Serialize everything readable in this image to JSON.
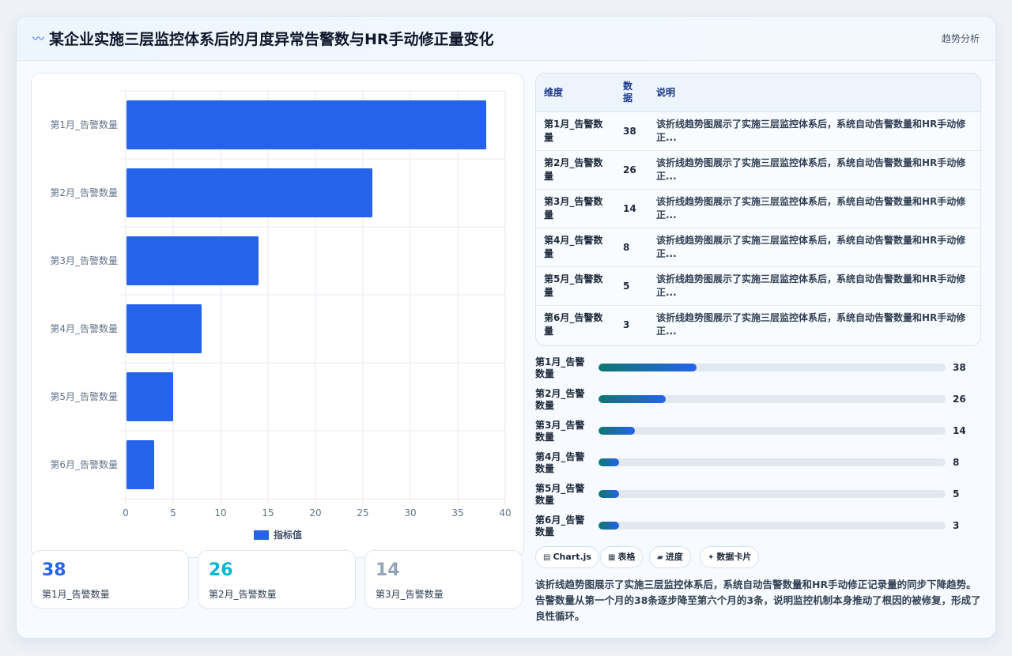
{
  "header": {
    "icon": "trend-icon",
    "title": "某企业实施三层监控体系后的月度异常告警数与HR手动修正量变化",
    "tag": "趋势分析"
  },
  "chart_data": {
    "type": "bar",
    "orientation": "horizontal",
    "categories": [
      "第1月_告警数量",
      "第2月_告警数量",
      "第3月_告警数量",
      "第4月_告警数量",
      "第5月_告警数量",
      "第6月_告警数量"
    ],
    "series": [
      {
        "name": "指标值",
        "values": [
          38,
          26,
          14,
          8,
          5,
          3
        ],
        "color": "#2563eb"
      }
    ],
    "xlim": [
      0,
      40
    ],
    "xticks": [
      0,
      5,
      10,
      15,
      20,
      25,
      30,
      35,
      40
    ],
    "grid": true,
    "legend": "bottom"
  },
  "kpis": [
    {
      "value": "38",
      "label": "第1月_告警数量",
      "color": "#2563eb"
    },
    {
      "value": "26",
      "label": "第2月_告警数量",
      "color": "#06b6d4"
    },
    {
      "value": "14",
      "label": "第3月_告警数量",
      "color": "#94a3b8"
    }
  ],
  "table": {
    "headers": [
      "维度",
      "数据",
      "说明"
    ],
    "rows": [
      {
        "dim": "第1月_告警数量",
        "val": "38",
        "desc": "该折线趋势图展示了实施三层监控体系后，系统自动告警数量和HR手动修正..."
      },
      {
        "dim": "第2月_告警数量",
        "val": "26",
        "desc": "该折线趋势图展示了实施三层监控体系后，系统自动告警数量和HR手动修正..."
      },
      {
        "dim": "第3月_告警数量",
        "val": "14",
        "desc": "该折线趋势图展示了实施三层监控体系后，系统自动告警数量和HR手动修正..."
      },
      {
        "dim": "第4月_告警数量",
        "val": "8",
        "desc": "该折线趋势图展示了实施三层监控体系后，系统自动告警数量和HR手动修正..."
      },
      {
        "dim": "第5月_告警数量",
        "val": "5",
        "desc": "该折线趋势图展示了实施三层监控体系后，系统自动告警数量和HR手动修正..."
      },
      {
        "dim": "第6月_告警数量",
        "val": "3",
        "desc": "该折线趋势图展示了实施三层监控体系后，系统自动告警数量和HR手动修正..."
      }
    ]
  },
  "progress": {
    "max": 135,
    "items": [
      {
        "label": "第1月_告警数量",
        "value": 38
      },
      {
        "label": "第2月_告警数量",
        "value": 26
      },
      {
        "label": "第3月_告警数量",
        "value": 14
      },
      {
        "label": "第4月_告警数量",
        "value": 8
      },
      {
        "label": "第5月_告警数量",
        "value": 5
      },
      {
        "label": "第6月_告警数量",
        "value": 3
      }
    ]
  },
  "chips": [
    {
      "icon": "chart-icon",
      "glyph": "▤",
      "label": "Chart.js"
    },
    {
      "icon": "table-icon",
      "glyph": "▦",
      "label": "表格"
    },
    {
      "icon": "progress-icon",
      "glyph": "▰",
      "label": "进度"
    },
    {
      "icon": "sparkle-icon",
      "glyph": "✦",
      "label": "数据卡片"
    }
  ],
  "description": "该折线趋势图展示了实施三层监控体系后，系统自动告警数量和HR手动修正记录量的同步下降趋势。告警数量从第一个月的38条逐步降至第六个月的3条，说明监控机制本身推动了根因的被修复，形成了良性循环。"
}
